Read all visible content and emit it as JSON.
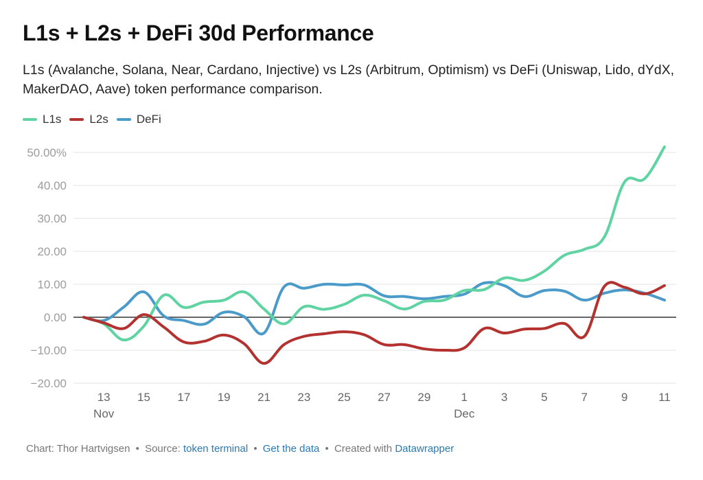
{
  "title": "L1s + L2s + DeFi 30d Performance",
  "subtitle": "L1s (Avalanche, Solana, Near, Cardano, Injective) vs L2s (Arbitrum, Optimism) vs DeFi (Uniswap, Lido, dYdX, MakerDAO, Aave) token performance comparison.",
  "footer": {
    "prefix": "Chart: Thor Hartvigsen",
    "source_label": "Source:",
    "source_link": "token terminal",
    "get_data_link": "Get the data",
    "created_label": "Created with",
    "created_link": "Datawrapper",
    "separator": "•"
  },
  "chart_data": {
    "type": "line",
    "title": "L1s + L2s + DeFi 30d Performance",
    "xlabel": "",
    "ylabel": "",
    "ylim": [
      -20,
      50
    ],
    "y_ticks": [
      {
        "value": 50,
        "label": "50.00%"
      },
      {
        "value": 40,
        "label": "40.00"
      },
      {
        "value": 30,
        "label": "30.00"
      },
      {
        "value": 20,
        "label": "20.00"
      },
      {
        "value": 10,
        "label": "10.00"
      },
      {
        "value": 0,
        "label": "0.00"
      },
      {
        "value": -10,
        "label": "-10.00"
      },
      {
        "value": -20,
        "label": "-20.00"
      }
    ],
    "x_start": "Nov 12",
    "x_end": "Dec 11",
    "x_ticks": [
      {
        "day": 1,
        "label": "13",
        "sublabel": "Nov"
      },
      {
        "day": 3,
        "label": "15"
      },
      {
        "day": 5,
        "label": "17"
      },
      {
        "day": 7,
        "label": "19"
      },
      {
        "day": 9,
        "label": "21"
      },
      {
        "day": 11,
        "label": "23"
      },
      {
        "day": 13,
        "label": "25"
      },
      {
        "day": 15,
        "label": "27"
      },
      {
        "day": 17,
        "label": "29"
      },
      {
        "day": 19,
        "label": "1",
        "sublabel": "Dec"
      },
      {
        "day": 21,
        "label": "3"
      },
      {
        "day": 23,
        "label": "5"
      },
      {
        "day": 25,
        "label": "7"
      },
      {
        "day": 27,
        "label": "9"
      },
      {
        "day": 29,
        "label": "11"
      }
    ],
    "x": [
      "Nov 12",
      "Nov 13",
      "Nov 14",
      "Nov 15",
      "Nov 16",
      "Nov 17",
      "Nov 18",
      "Nov 19",
      "Nov 20",
      "Nov 21",
      "Nov 22",
      "Nov 23",
      "Nov 24",
      "Nov 25",
      "Nov 26",
      "Nov 27",
      "Nov 28",
      "Nov 29",
      "Nov 30",
      "Dec 1",
      "Dec 2",
      "Dec 3",
      "Dec 4",
      "Dec 5",
      "Dec 6",
      "Dec 7",
      "Dec 8",
      "Dec 9",
      "Dec 10",
      "Dec 11"
    ],
    "grid": true,
    "zero_line": true,
    "legend_position": "top-left",
    "series": [
      {
        "name": "L1s",
        "color": "#5fd3a1",
        "values": [
          0,
          -2.0,
          -6.9,
          -2.7,
          6.7,
          3.0,
          4.6,
          5.2,
          7.7,
          2.5,
          -2.0,
          3.2,
          2.4,
          3.9,
          6.7,
          5.0,
          2.5,
          4.8,
          5.2,
          8.1,
          8.4,
          11.9,
          11.2,
          14.0,
          18.8,
          20.6,
          24.4,
          41.0,
          42.0,
          51.7
        ]
      },
      {
        "name": "L2s",
        "color": "#b3322f",
        "values": [
          0,
          -1.7,
          -3.4,
          0.8,
          -3.0,
          -7.5,
          -7.3,
          -5.4,
          -8.0,
          -14.0,
          -8.3,
          -5.8,
          -5.0,
          -4.4,
          -5.3,
          -8.3,
          -8.3,
          -9.6,
          -10.0,
          -9.3,
          -3.4,
          -4.8,
          -3.6,
          -3.4,
          -1.9,
          -5.8,
          9.4,
          9.1,
          7.1,
          9.6
        ]
      },
      {
        "name": "DeFi",
        "color": "#4a9bc9",
        "values": [
          0,
          -1.0,
          3.1,
          7.7,
          0.4,
          -1.0,
          -2.1,
          1.5,
          0.2,
          -4.8,
          9.2,
          8.8,
          10.0,
          9.8,
          9.8,
          6.5,
          6.3,
          5.6,
          6.3,
          7.0,
          10.4,
          9.6,
          6.3,
          8.1,
          7.9,
          5.2,
          7.3,
          8.3,
          7.3,
          5.2
        ]
      }
    ]
  }
}
